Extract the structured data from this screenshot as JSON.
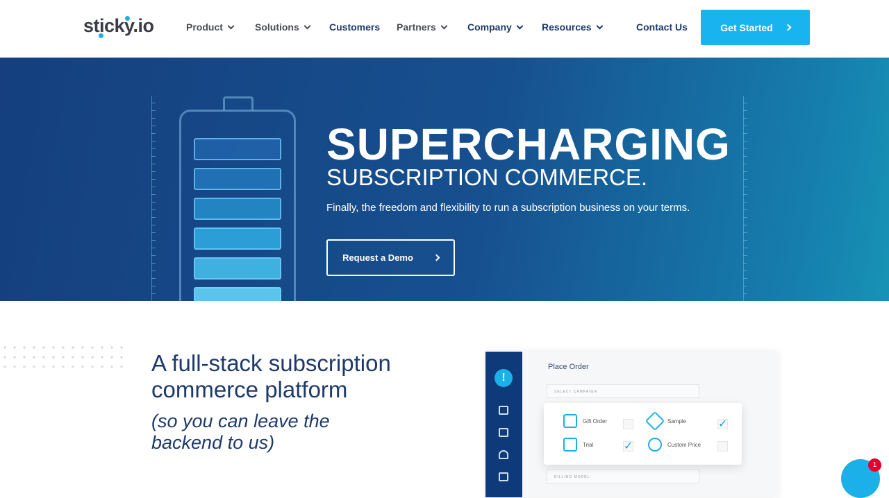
{
  "nav": {
    "logo": "sticky.io",
    "items": [
      {
        "label": "Product",
        "dropdown": true
      },
      {
        "label": "Solutions",
        "dropdown": true
      },
      {
        "label": "Customers",
        "dropdown": false
      },
      {
        "label": "Partners",
        "dropdown": true
      },
      {
        "label": "Company",
        "dropdown": true
      },
      {
        "label": "Resources",
        "dropdown": true
      }
    ],
    "contact": "Contact Us",
    "cta": "Get Started"
  },
  "hero": {
    "title": "SUPERCHARGING",
    "subtitle": "SUBSCRIPTION COMMERCE.",
    "tagline": "Finally, the freedom and flexibility to run a subscription business on your terms.",
    "button": "Request a Demo"
  },
  "feature": {
    "heading_line1": "A full-stack subscription",
    "heading_line2": "commerce platform",
    "aside_line1": "(so you can leave the",
    "aside_line2": "backend to us)"
  },
  "mockup": {
    "title": "Place Order",
    "select_campaign": "SELECT CAMPAIGN",
    "billing_model": "BILLING MODEL",
    "options": [
      {
        "label": "Gift Order",
        "checked": false,
        "icon": "gift-icon"
      },
      {
        "label": "Sample",
        "checked": true,
        "icon": "tag-icon"
      },
      {
        "label": "Trial",
        "checked": true,
        "icon": "calendar-icon"
      },
      {
        "label": "Custom Price",
        "checked": false,
        "icon": "price-tag-icon"
      }
    ]
  },
  "chat": {
    "badge": "1"
  },
  "colors": {
    "accent": "#18b4ef",
    "navy": "#1d3a6b"
  }
}
